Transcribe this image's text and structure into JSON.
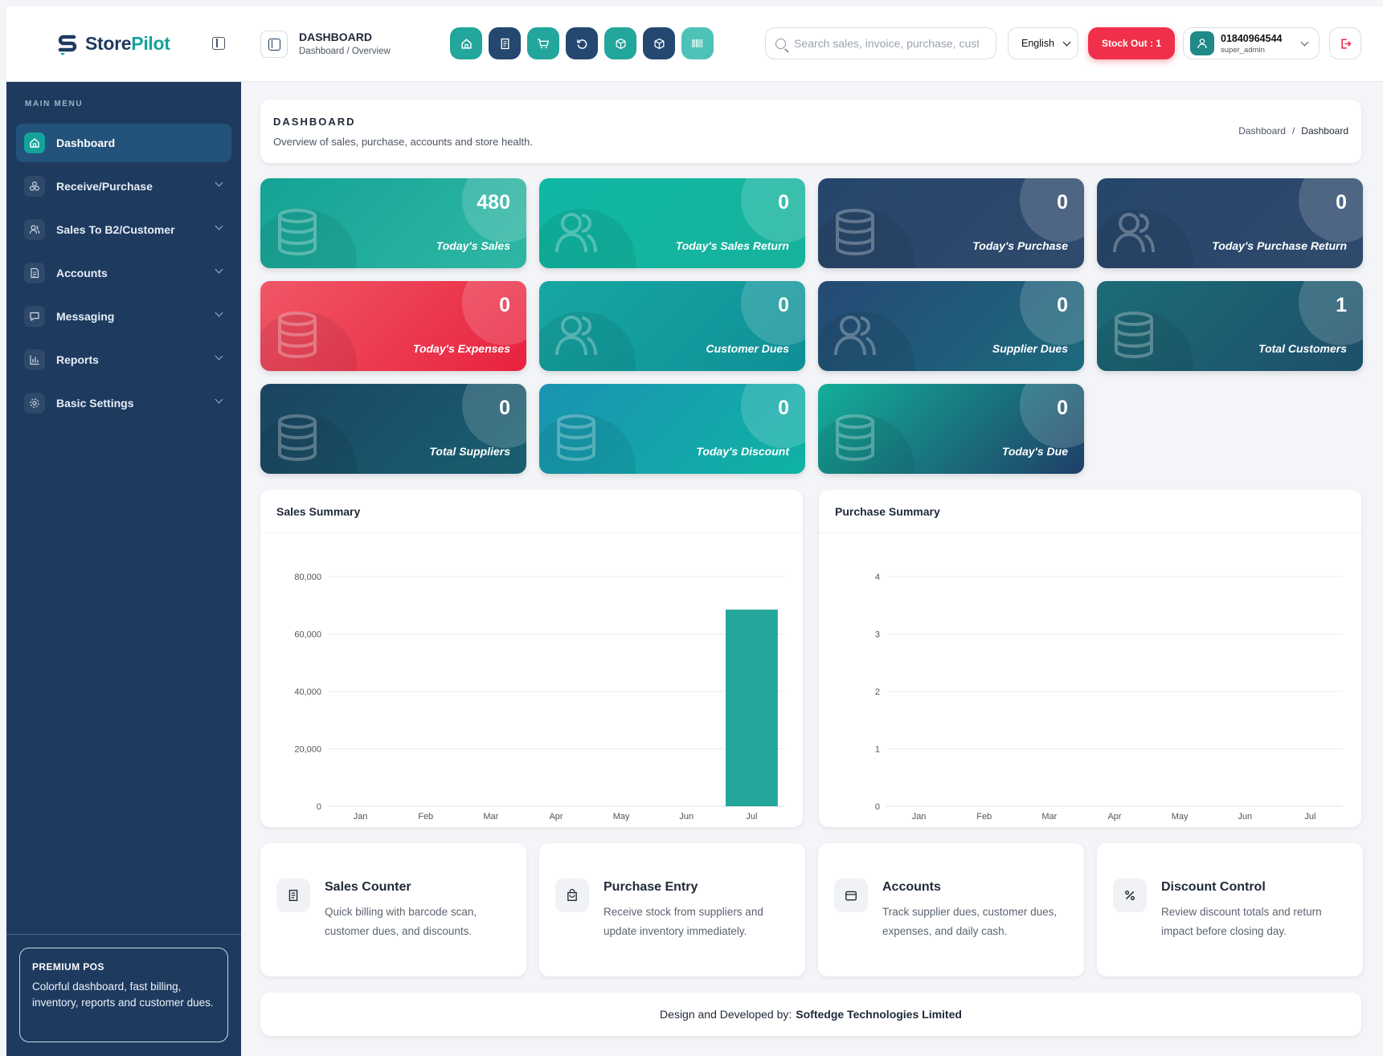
{
  "app": {
    "name_part1": "Store",
    "name_part2": "Pilot"
  },
  "sidebar": {
    "menu_title": "MAIN MENU",
    "items": [
      {
        "label": "Dashboard",
        "icon": "home-icon",
        "active": true
      },
      {
        "label": "Receive/Purchase",
        "icon": "boxes-icon"
      },
      {
        "label": "Sales To B2/Customer",
        "icon": "users-icon"
      },
      {
        "label": "Accounts",
        "icon": "document-icon"
      },
      {
        "label": "Messaging",
        "icon": "chat-icon"
      },
      {
        "label": "Reports",
        "icon": "bar-chart-icon"
      },
      {
        "label": "Basic Settings",
        "icon": "gear-icon"
      }
    ],
    "premium": {
      "title": "PREMIUM POS",
      "desc": "Colorful dashboard, fast billing, inventory, reports and customer dues."
    }
  },
  "topbar": {
    "title": "DASHBOARD",
    "breadcrumb": "Dashboard / Overview",
    "quick_actions": [
      "home-icon",
      "receipt-icon",
      "cart-icon",
      "refresh-icon",
      "box-plus-icon",
      "box-x-icon",
      "barcode-icon"
    ],
    "search_placeholder": "Search sales, invoice, purchase, customer",
    "language": "English",
    "stock_out": "Stock Out : 1",
    "user": {
      "name": "01840964544",
      "role": "super_admin"
    }
  },
  "page_header": {
    "title": "DASHBOARD",
    "desc": "Overview of sales, purchase, accounts and store health.",
    "crumb_home": "Dashboard",
    "crumb_sep": "/",
    "crumb_current": "Dashboard"
  },
  "stats": [
    {
      "value": "480",
      "label": "Today's Sales"
    },
    {
      "value": "0",
      "label": "Today's Sales Return"
    },
    {
      "value": "0",
      "label": "Today's Purchase"
    },
    {
      "value": "0",
      "label": "Today's Purchase Return"
    },
    {
      "value": "0",
      "label": "Today's Expenses"
    },
    {
      "value": "0",
      "label": "Customer Dues"
    },
    {
      "value": "0",
      "label": "Supplier Dues"
    },
    {
      "value": "1",
      "label": "Total Customers"
    },
    {
      "value": "0",
      "label": "Total Suppliers"
    },
    {
      "value": "0",
      "label": "Today's Discount"
    },
    {
      "value": "0",
      "label": "Today's Due"
    }
  ],
  "colors": {
    "accent": "#14a39a",
    "sidebar": "#1e3a5f",
    "danger": "#f0304a"
  },
  "chart_data": [
    {
      "type": "bar",
      "title": "Sales Summary",
      "categories": [
        "Jan",
        "Feb",
        "Mar",
        "Apr",
        "May",
        "Jun",
        "Jul"
      ],
      "values": [
        0,
        0,
        0,
        0,
        0,
        0,
        68500
      ],
      "ylim": [
        0,
        80000
      ],
      "yticks": [
        0,
        20000,
        40000,
        60000,
        80000
      ],
      "ytick_labels": [
        "0",
        "20,000",
        "40,000",
        "60,000",
        "80,000"
      ],
      "color": "#25a69b"
    },
    {
      "type": "bar",
      "title": "Purchase Summary",
      "categories": [
        "Jan",
        "Feb",
        "Mar",
        "Apr",
        "May",
        "Jun",
        "Jul"
      ],
      "values": [
        0,
        0,
        0,
        0,
        0,
        0,
        0
      ],
      "ylim": [
        0,
        4
      ],
      "yticks": [
        0,
        1,
        2,
        3,
        4
      ],
      "ytick_labels": [
        "0",
        "1",
        "2",
        "3",
        "4"
      ],
      "color": "#25a69b"
    }
  ],
  "features": [
    {
      "title": "Sales Counter",
      "desc": "Quick billing with barcode scan, customer dues, and discounts.",
      "icon": "receipt-icon"
    },
    {
      "title": "Purchase Entry",
      "desc": "Receive stock from suppliers and update inventory immediately.",
      "icon": "bag-icon"
    },
    {
      "title": "Accounts",
      "desc": "Track supplier dues, customer dues, expenses, and daily cash.",
      "icon": "wallet-icon"
    },
    {
      "title": "Discount Control",
      "desc": "Review discount totals and return impact before closing day.",
      "icon": "percent-icon"
    }
  ],
  "footer": {
    "prefix": "Design and Developed by:",
    "company": "Softedge Technologies Limited"
  }
}
